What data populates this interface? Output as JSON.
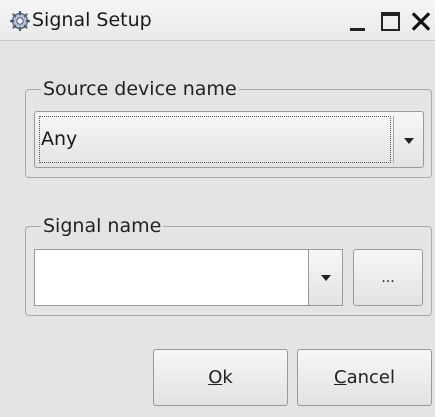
{
  "window": {
    "title": "Signal Setup",
    "icon": "gear-icon"
  },
  "source_group": {
    "legend": "Source device name",
    "selected_value": "Any"
  },
  "signal_group": {
    "legend": "Signal name",
    "input_value": "",
    "browse_label": "..."
  },
  "buttons": {
    "ok_mnemonic": "O",
    "ok_rest": "k",
    "cancel_mnemonic": "C",
    "cancel_rest": "ancel"
  }
}
